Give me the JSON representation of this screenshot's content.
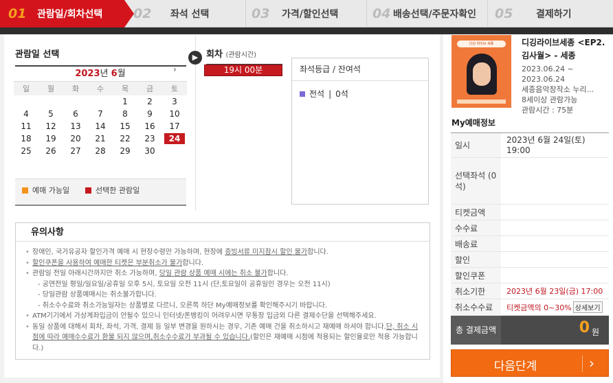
{
  "steps": [
    {
      "num": "01",
      "label": "관람일/회차선택"
    },
    {
      "num": "02",
      "label": "좌석 선택"
    },
    {
      "num": "03",
      "label": "가격/할인선택"
    },
    {
      "num": "04",
      "label": "배송선택/주문자확인"
    },
    {
      "num": "05",
      "label": "결제하기"
    }
  ],
  "date_section": {
    "title": "관람일 선택",
    "year": "2023",
    "year_unit": "년",
    "month": "6",
    "month_unit": "월",
    "next": "›",
    "weekdays": [
      "일",
      "월",
      "화",
      "수",
      "목",
      "금",
      "토"
    ],
    "weeks": [
      [
        "",
        "",
        "",
        "",
        "1",
        "2",
        "3"
      ],
      [
        "4",
        "5",
        "6",
        "7",
        "8",
        "9",
        "10"
      ],
      [
        "11",
        "12",
        "13",
        "14",
        "15",
        "16",
        "17"
      ],
      [
        "18",
        "19",
        "20",
        "21",
        "22",
        "23",
        "24"
      ],
      [
        "25",
        "26",
        "27",
        "28",
        "29",
        "30",
        ""
      ]
    ],
    "selected_day": "24",
    "legend_available": "예매 가능일",
    "legend_selected": "선택한 관람일",
    "legend_available_color": "#f7941d",
    "legend_selected_color": "#c51a1f"
  },
  "round_section": {
    "title": "회차",
    "subtitle": "(관람시간)",
    "selected_time": "19시 00분"
  },
  "seat_section": {
    "header": "좌석등급 / 잔여석",
    "grade": "전석",
    "sep": "|",
    "remaining": "0석"
  },
  "notice": {
    "title": "유의사항",
    "lines": [
      {
        "type": "bullet",
        "html": "장애인, 국가유공자 할인가격 예매 시 현장수령만 가능하며, 현장에 <u>증빙서류 미지참시 할인 불가</u>합니다."
      },
      {
        "type": "bullet",
        "html": "<u>할인쿠폰을 사용하여 예매한 티켓은 부분취소가 불가</u>합니다."
      },
      {
        "type": "bullet",
        "html": "관람일 전일 아래시간까지만 취소 가능하며, <u>당일 관람 상품 예매 시에는 취소 불가</u>합니다."
      },
      {
        "type": "sub",
        "html": "- 공연전일 평일/일요일/공휴일 오후 5시, 토요일 오전 11시 (단,토요일이 공휴일인 경우는 오전 11시)"
      },
      {
        "type": "sub",
        "html": "- 당일관람 상품예매시는 취소불가합니다."
      },
      {
        "type": "sub",
        "html": "- 취소수수료와 취소가능일자는 상품별로 다르니, 오른쪽 하단 My예매정보를 확인해주시기 바랍니다."
      },
      {
        "type": "bullet",
        "html": "ATM기기에서 가상계좌입금이 안될수 있으니 인터넷/폰뱅킹이 어려우시면 무통장 입금외 다른 결제수단을 선택해주세요."
      },
      {
        "type": "bullet",
        "html": "동일 상품에 대해서 회차, 좌석, 가격, 결제 등 일부 변경을 원하시는 경우, 기존 예매 건을 취소하시고 재예매 하셔야 합니다.<u>단, 취소 시점에 따라 예매수수료가 환불 되지 않으며,취소수수료가 부과될 수 있습니다.</u>(할인은 재예매 시점에 적용되는 할인율로만 적용 가능합니다.)"
      }
    ]
  },
  "product": {
    "poster_text": "디깅 라이브 세종",
    "title": "디깅라이브세종 <EP2. 김사월> - 세종",
    "date_range": "2023.06.24 ~ 2023.06.24",
    "venue": "세종음악창작소 누리...",
    "age": "8세이상 관람가능",
    "runtime": "관람시간 : 75분"
  },
  "my_booking": {
    "title": "My예매정보",
    "rows": [
      {
        "key": "일시",
        "value": "2023년 6월 24일(토) 19:00"
      },
      {
        "key": "선택좌석 (0석)",
        "value": ""
      },
      {
        "key": "티켓금액",
        "value": ""
      },
      {
        "key": "수수료",
        "value": ""
      },
      {
        "key": "배송료",
        "value": ""
      },
      {
        "key": "할인",
        "value": ""
      },
      {
        "key": "할인쿠폰",
        "value": ""
      },
      {
        "key": "취소기한",
        "value": "2023년 6월 23일(금) 17:00"
      },
      {
        "key": "취소수수료",
        "value": "티켓금액의 0~30%"
      }
    ],
    "detail_button": "상세보기",
    "total_label": "총 결제금액",
    "total_value": "0",
    "total_unit": "원"
  },
  "next_button": "다음단계",
  "colors": {
    "accent_red": "#c51a1f",
    "accent_orange": "#f26a11"
  }
}
